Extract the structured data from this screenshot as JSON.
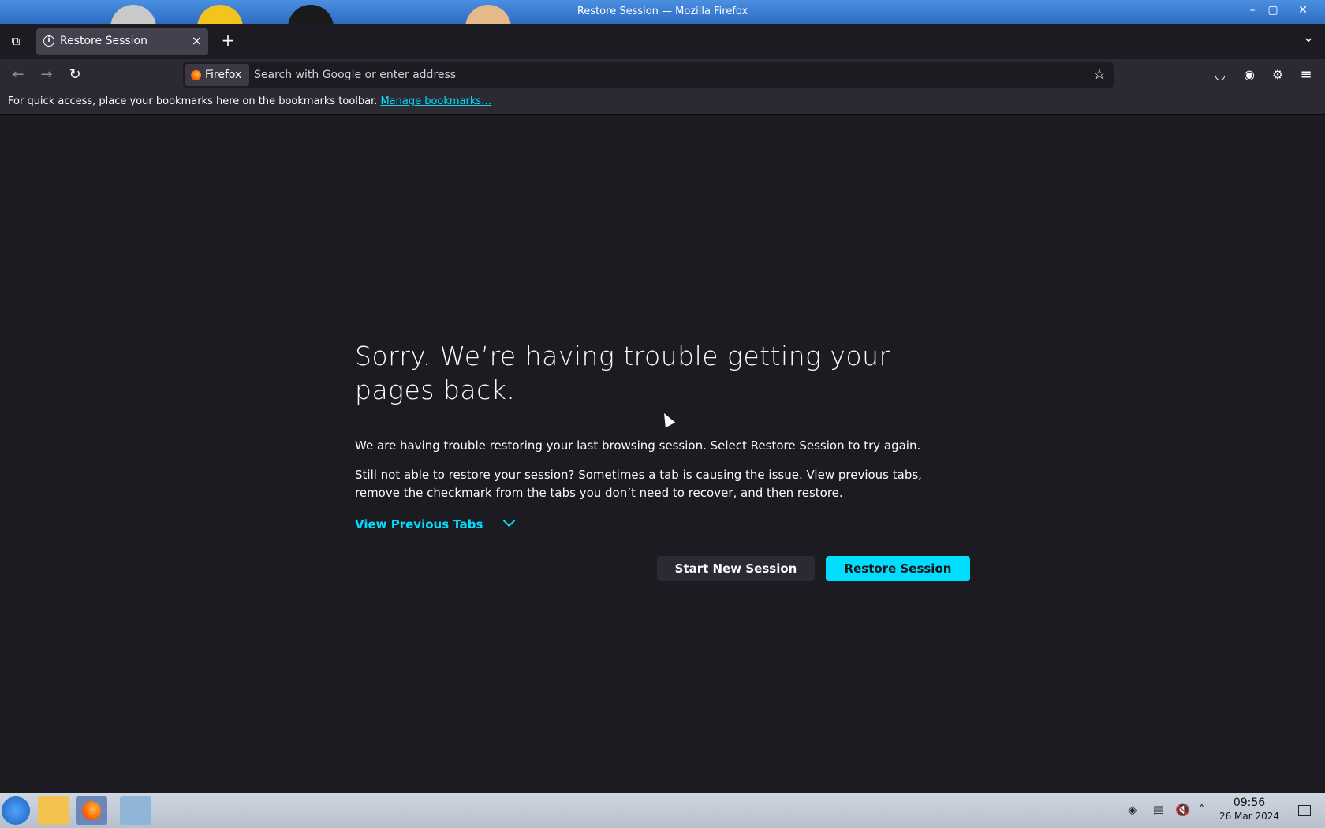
{
  "window": {
    "title": "Restore Session — Mozilla Firefox",
    "minimize_label": "–",
    "maximize_label": "▢",
    "close_label": "✕"
  },
  "tabs": {
    "list_all_icon": "⧉",
    "active_tab_label": "Restore Session",
    "close_tab_label": "×",
    "new_tab_label": "+",
    "overflow_label": "⌄"
  },
  "nav": {
    "back_label": "←",
    "forward_label": "→",
    "reload_label": "↻",
    "identity_label": "Firefox",
    "url_placeholder": "Search with Google or enter address",
    "star_label": "☆",
    "pocket_label": "◡",
    "account_label": "◉",
    "extensions_label": "⚙",
    "menu_label": "≡"
  },
  "bookmarks_bar": {
    "message": "For quick access, place your bookmarks here on the bookmarks toolbar.",
    "manage_link": "Manage bookmarks…"
  },
  "content": {
    "heading": "Sorry. We’re having trouble getting your pages back.",
    "paragraph1": "We are having trouble restoring your last browsing session. Select Restore Session to try again.",
    "paragraph2": "Still not able to restore your session? Sometimes a tab is causing the issue. View previous tabs, remove the checkmark from the tabs you don’t need to recover, and then restore.",
    "view_previous_tabs": "View Previous Tabs",
    "start_new_session": "Start New Session",
    "restore_session": "Restore Session"
  },
  "taskbar": {
    "time": "09:56",
    "date": "26 Mar 2024",
    "volume_label": "🔇",
    "tray_up_label": "˄"
  },
  "colors": {
    "accent": "#00ddff",
    "page_bg": "#1c1b22",
    "toolbar_bg": "#2b2a33"
  }
}
